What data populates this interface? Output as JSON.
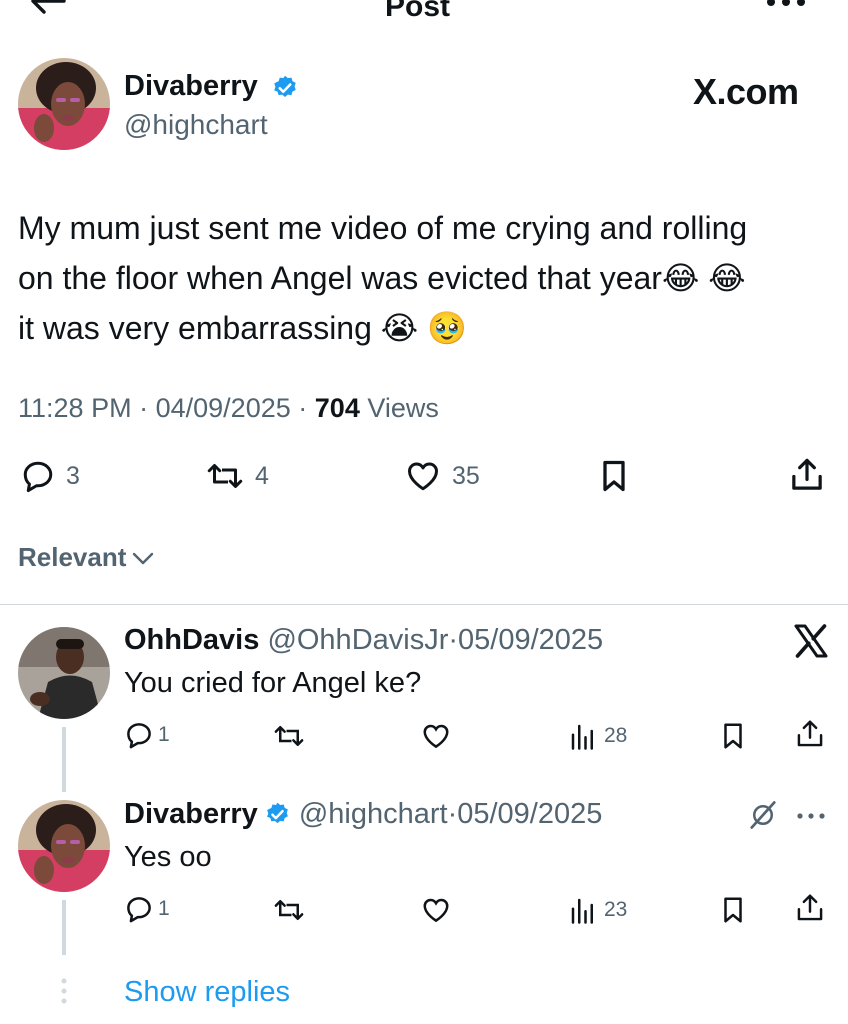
{
  "header": {
    "title": "Post"
  },
  "colors": {
    "verified": "#1d9bf0",
    "text": "#0f1419",
    "muted": "#536471",
    "link": "#1d9bf0",
    "divider": "#cfd9de"
  },
  "post": {
    "author": {
      "name": "Divaberry",
      "handle": "@highchart"
    },
    "brand": "X.com",
    "text_line1": "My mum just sent me video of me crying and rolling",
    "text_line2": "on the floor when Angel was evicted that year",
    "text_line2_emoji": "😂 😂",
    "text_line3": "it was very embarrassing",
    "text_line3_emoji": "😭 🥹",
    "time": "11:28 PM",
    "date": "04/09/2025",
    "views_count": "704",
    "views_label": "Views",
    "separator": "·",
    "replies": "3",
    "reposts": "4",
    "likes": "35"
  },
  "filter": {
    "label": "Relevant"
  },
  "replies": [
    {
      "name": "OhhDavis",
      "handle": "@OhhDavisJr",
      "separator": "·",
      "date": "05/09/2025",
      "text": "You cried for Angel ke?",
      "reply_count": "1",
      "views": "28"
    },
    {
      "name": "Divaberry",
      "handle": "@highchart",
      "separator": "·",
      "date": "05/09/2025",
      "text": "Yes oo",
      "reply_count": "1",
      "views": "23"
    }
  ],
  "show_replies": "Show replies",
  "icons": [
    "back-arrow-icon",
    "more-icon",
    "verified-badge-icon",
    "reply-icon",
    "repost-icon",
    "like-icon",
    "bookmark-icon",
    "share-icon",
    "analytics-icon",
    "x-logo-icon",
    "grok-icon",
    "chevron-down-icon"
  ]
}
